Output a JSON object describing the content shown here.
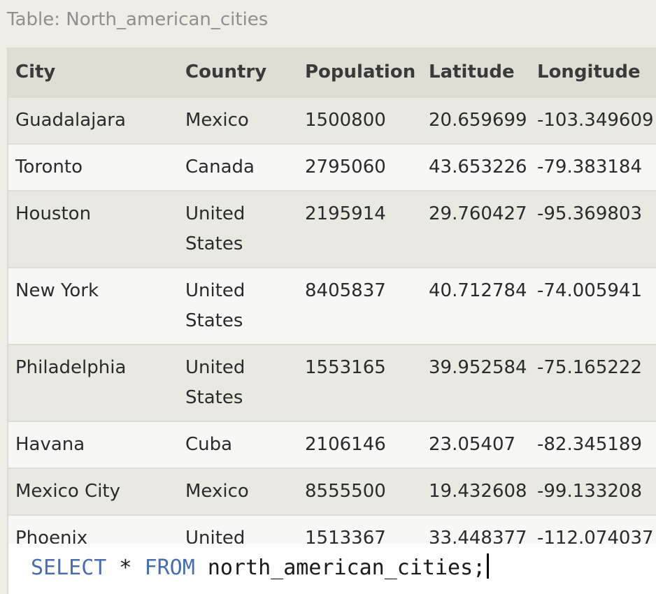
{
  "caption": "Table: North_american_cities",
  "table": {
    "headers": [
      "City",
      "Country",
      "Population",
      "Latitude",
      "Longitude"
    ],
    "rows": [
      [
        "Guadalajara",
        "Mexico",
        "1500800",
        "20.659699",
        "-103.349609"
      ],
      [
        "Toronto",
        "Canada",
        "2795060",
        "43.653226",
        "-79.383184"
      ],
      [
        "Houston",
        "United States",
        "2195914",
        "29.760427",
        "-95.369803"
      ],
      [
        "New York",
        "United States",
        "8405837",
        "40.712784",
        "-74.005941"
      ],
      [
        "Philadelphia",
        "United States",
        "1553165",
        "39.952584",
        "-75.165222"
      ],
      [
        "Havana",
        "Cuba",
        "2106146",
        "23.05407",
        "-82.345189"
      ],
      [
        "Mexico City",
        "Mexico",
        "8555500",
        "19.432608",
        "-99.133208"
      ],
      [
        "Phoenix",
        "United States",
        "1513367",
        "33.448377",
        "-112.074037"
      ]
    ]
  },
  "query": {
    "kw_select": "SELECT",
    "star": " * ",
    "kw_from": "FROM",
    "rest": " north_american_cities;"
  }
}
